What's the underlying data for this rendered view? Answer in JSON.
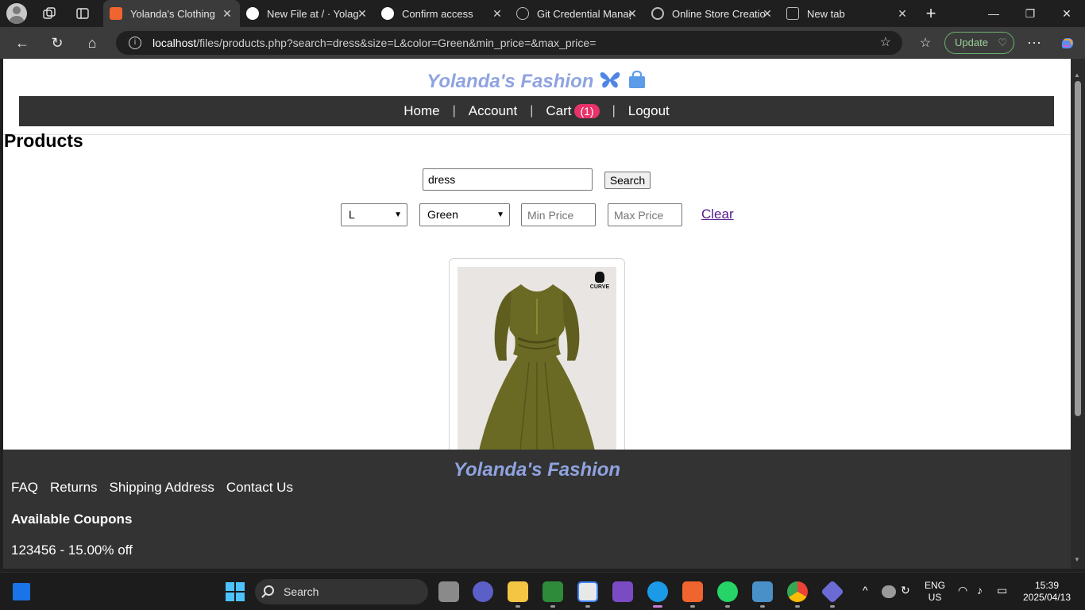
{
  "browser": {
    "tabs": [
      {
        "title": "Yolanda's Clothing",
        "favicon_color": "#f0642f",
        "active": true
      },
      {
        "title": "New File at / · Yolag",
        "favicon_color": "#ffffff",
        "active": false
      },
      {
        "title": "Confirm access",
        "favicon_color": "#ffffff",
        "active": false
      },
      {
        "title": "Git Credential Manag",
        "favicon_color": "#bdbdbd",
        "active": false
      },
      {
        "title": "Online Store Creatio",
        "favicon_color": "#bdbdbd",
        "active": false
      },
      {
        "title": "New tab",
        "favicon_color": "#bdbdbd",
        "active": false
      }
    ],
    "url_host": "localhost",
    "url_path": "/files/products.php?search=dress&size=L&color=Green&min_price=&max_price=",
    "update_label": "Update"
  },
  "site": {
    "brand": "Yolanda's Fashion",
    "nav": {
      "home": "Home",
      "account": "Account",
      "cart": "Cart",
      "cart_count": "(1)",
      "logout": "Logout",
      "separator": "|"
    },
    "page_title": "Products",
    "search": {
      "value": "dress",
      "button": "Search"
    },
    "filters": {
      "size": "L",
      "color": "Green",
      "min_price_placeholder": "Min Price",
      "max_price_placeholder": "Max Price",
      "clear": "Clear"
    },
    "product": {
      "image_logo": "CURVE",
      "dress_color": "#6b6a24"
    },
    "footer": {
      "brand": "Yolanda's Fashion",
      "links": [
        "FAQ",
        "Returns",
        "Shipping Address",
        "Contact Us"
      ],
      "coupons_title": "Available Coupons",
      "coupon": "123456 - 15.00% off"
    }
  },
  "taskbar": {
    "search_label": "Search",
    "lang_top": "ENG",
    "lang_bottom": "US",
    "time": "15:39",
    "date": "2025/04/13"
  },
  "colors": {
    "brand": "#8fa3e0",
    "navbar": "#333333",
    "badge": "#e8336a",
    "link_visited": "#551a8b"
  }
}
